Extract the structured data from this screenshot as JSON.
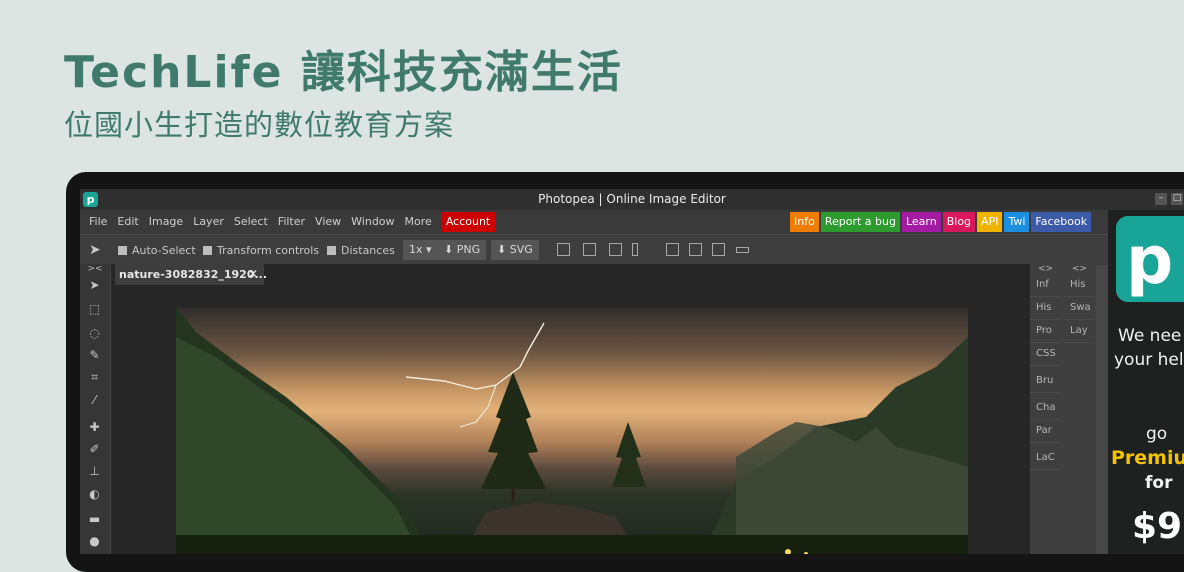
{
  "page": {
    "headline": "TechLife 讓科技充滿生活",
    "subheadline": "位國小生打造的數位教育方案"
  },
  "app": {
    "window_title": "Photopea | Online Image Editor",
    "logo_letter": "p",
    "menu": [
      "File",
      "Edit",
      "Image",
      "Layer",
      "Select",
      "Filter",
      "View",
      "Window",
      "More"
    ],
    "account_label": "Account",
    "links": [
      {
        "label": "Info",
        "color": "#f07c00"
      },
      {
        "label": "Report a bug",
        "color": "#2e9b2e"
      },
      {
        "label": "Learn",
        "color": "#a31ba3"
      },
      {
        "label": "Blog",
        "color": "#d8185a"
      },
      {
        "label": "API",
        "color": "#f0b400"
      },
      {
        "label": "Twi",
        "color": "#1d8fe0"
      },
      {
        "label": "Facebook",
        "color": "#3b5aa8"
      }
    ],
    "options": {
      "auto_select": "Auto-Select",
      "transform_controls": "Transform controls",
      "distances": "Distances",
      "zoom": "1x ▾",
      "export_png": "PNG",
      "export_svg": "SVG"
    },
    "document_tab": "nature-3082832_1920...",
    "panels_left": [
      "Inf",
      "His",
      "Pro",
      "CSS",
      "Bru",
      "Cha",
      "Par",
      "LaC"
    ],
    "panels_right": [
      "His",
      "Swa",
      "Lay"
    ],
    "ad": {
      "line1": "We nee",
      "line2": "your hel",
      "line3": "go",
      "premium": "Premiu",
      "line4": "for",
      "price": "$9"
    }
  }
}
